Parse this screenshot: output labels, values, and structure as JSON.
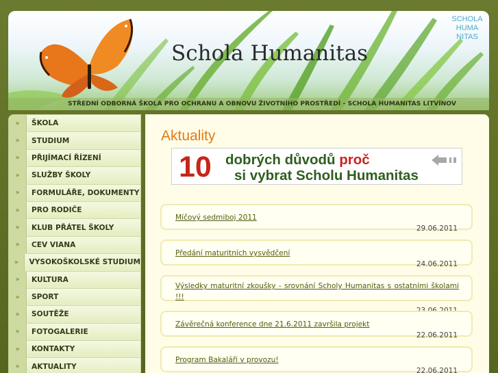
{
  "header": {
    "site_title": "Schola Humanitas",
    "tagline": "STŘEDNÍ ODBORNÁ ŠKOLA PRO OCHRANU A OBNOVU ŽIVOTNÍHO PROSTŘEDÍ - SCHOLA HUMANITAS LITVÍNOV",
    "logo_lines": [
      "SCHOLA",
      "HUMA",
      "NITAS"
    ]
  },
  "sidebar": {
    "bullet": "»",
    "items": [
      {
        "label": "ŠKOLA"
      },
      {
        "label": "STUDIUM"
      },
      {
        "label": "PŘIJÍMACÍ ŘÍZENÍ"
      },
      {
        "label": "SLUŽBY ŠKOLY"
      },
      {
        "label": "FORMULÁŘE, DOKUMENTY"
      },
      {
        "label": "PRO RODIČE"
      },
      {
        "label": "KLUB PŘÁTEL ŠKOLY"
      },
      {
        "label": "CEV VIANA"
      },
      {
        "label": "VYSOKOŠKOLSKÉ STUDIUM"
      },
      {
        "label": "KULTURA"
      },
      {
        "label": "SPORT"
      },
      {
        "label": "SOUTĚŽE"
      },
      {
        "label": "FOTOGALERIE"
      },
      {
        "label": "KONTAKTY"
      },
      {
        "label": "AKTUALITY"
      }
    ]
  },
  "main": {
    "heading": "Aktuality",
    "banner": {
      "number": "10",
      "line1_a": "dobrých důvodů ",
      "line1_b": "proč",
      "line2": "si vybrat Scholu Humanitas"
    },
    "news": [
      {
        "title": "Míčový sedmiboj 2011",
        "date": "29.06.2011"
      },
      {
        "title": "Předání maturitních vysvědčení",
        "date": "24.06.2011"
      },
      {
        "title": "Výsledky maturitní zkoušky - srovnání Scholy Humanitas s ostatními školami !!!",
        "date": "23.06.2011"
      },
      {
        "title": "Závěrečná konference dne 21.6.2011 završila projekt",
        "date": "22.06.2011"
      },
      {
        "title": "Program Bakaláři v provozu!",
        "date": "22.06.2011"
      }
    ]
  },
  "colors": {
    "background": "#5f6e2a",
    "heading_orange": "#e37a12",
    "link_olive": "#545c0d",
    "banner_red": "#c8241c",
    "banner_green": "#2e5e1e"
  }
}
